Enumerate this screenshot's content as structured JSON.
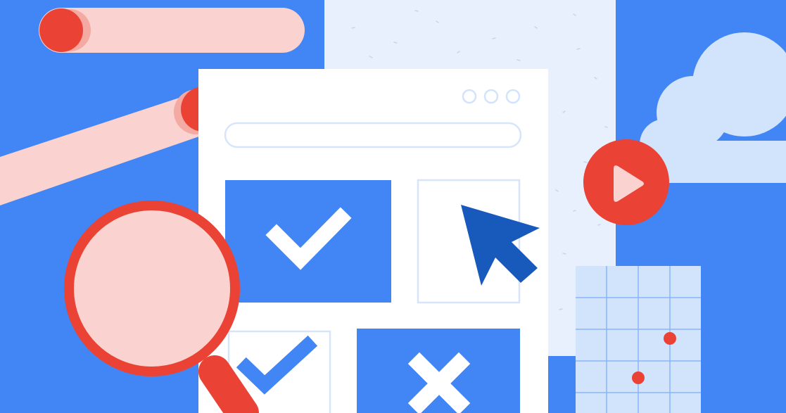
{
  "illustration": {
    "subject": "browser-window-with-checkboxes",
    "icons": [
      "checkmark-icon",
      "checkmark-outline-icon",
      "cross-icon",
      "cursor-arrow-icon",
      "play-icon",
      "magnifier-icon",
      "cloud-icon",
      "grid-chart-icon"
    ],
    "checked_states": {
      "tile_top_left": "checked",
      "tile_top_right": "empty",
      "tile_bottom_left": "checked",
      "tile_bottom_right": "rejected"
    },
    "colors": {
      "background_blue": "#4285f4",
      "card_white": "#ffffff",
      "paper_light_blue": "#e8f0fe",
      "cloud_light": "#d2e3fc",
      "accent_red": "#ea4335",
      "pill_pink": "#fad2cf",
      "cursor_dark_blue": "#185abc",
      "outline_light": "#d7e5fb"
    }
  }
}
